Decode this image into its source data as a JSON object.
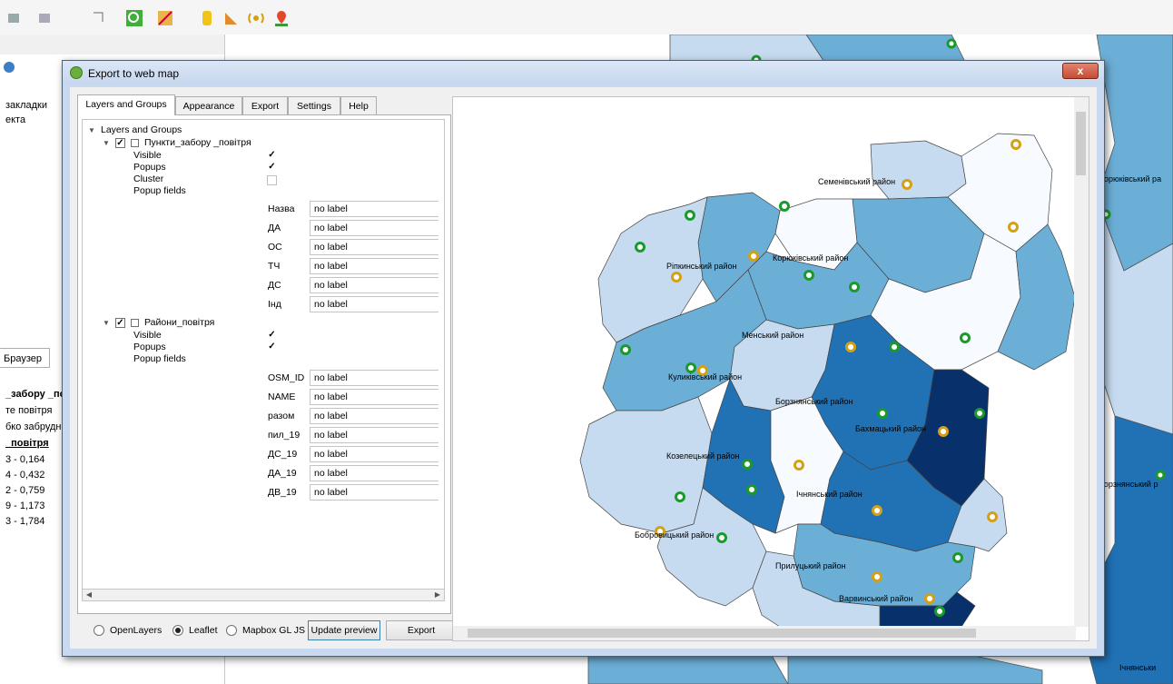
{
  "dialog": {
    "title": "Export to web map",
    "close_label": "x"
  },
  "tabs": [
    {
      "label": "Layers and Groups"
    },
    {
      "label": "Appearance"
    },
    {
      "label": "Export"
    },
    {
      "label": "Settings"
    },
    {
      "label": "Help"
    }
  ],
  "tree": {
    "root": "Layers and Groups",
    "layer1": {
      "name": "Пункти_забору _повітря",
      "visible_label": "Visible",
      "popups_label": "Popups",
      "cluster_label": "Cluster",
      "popup_fields_label": "Popup fields",
      "visible": true,
      "popups": true,
      "cluster": false,
      "fields": [
        {
          "name": "Назва",
          "value": "no label"
        },
        {
          "name": "ДА",
          "value": "no label"
        },
        {
          "name": "ОС",
          "value": "no label"
        },
        {
          "name": "ТЧ",
          "value": "no label"
        },
        {
          "name": "ДС",
          "value": "no label"
        },
        {
          "name": "Інд",
          "value": "no label"
        }
      ]
    },
    "layer2": {
      "name": "Райони_повітря",
      "visible_label": "Visible",
      "popups_label": "Popups",
      "popup_fields_label": "Popup fields",
      "visible": true,
      "popups": true,
      "fields": [
        {
          "name": "OSM_ID",
          "value": "no label"
        },
        {
          "name": "NAME",
          "value": "no label"
        },
        {
          "name": "разом",
          "value": "no label"
        },
        {
          "name": "пил_19",
          "value": "no label"
        },
        {
          "name": "ДС_19",
          "value": "no label"
        },
        {
          "name": "ДА_19",
          "value": "no label"
        },
        {
          "name": "ДВ_19",
          "value": "no label"
        }
      ]
    }
  },
  "bottom": {
    "radio_openlayers": "OpenLayers",
    "radio_leaflet": "Leaflet",
    "radio_mapbox": "Mapbox GL JS",
    "selected": "Leaflet",
    "update_preview": "Update preview",
    "export": "Export"
  },
  "map_labels": {
    "semenivskyi": "Семенівський район",
    "ripkynskyi": "Ріпкинський район",
    "koriukivskyi": "Корюківський район",
    "menskyi": "Менський район",
    "kulykivskyi": "Куликівський район",
    "borznianskyi": "Борзнянський район",
    "bakhmatskyi": "Бахмацький район",
    "kozeletskyi": "Козелецький район",
    "ichnianskyi": "Ічнянський район",
    "bobrovytskyi": "Бобровицький район",
    "prylutskyi": "Прилуцький район",
    "varvynskyi": "Варвинський район"
  },
  "background": {
    "left_panel_lines": [
      "закладки",
      "екта",
      "Браузер",
      "_забору _пов",
      "те повітря",
      "бко забрудн",
      "_повітря",
      "3 - 0,164",
      "4 - 0,432",
      "2 - 0,759",
      "9 - 1,173",
      "3 - 1,784"
    ],
    "bg_map_labels": [
      "орюківський ра",
      "Борзнянський р",
      "Ічнянськи"
    ]
  },
  "colors": {
    "very_light": "#f7fbff",
    "light": "#c6dbef",
    "medium": "#6baed6",
    "dark": "#2171b5",
    "very_dark": "#08306b",
    "point_green": "#1a9a2a",
    "point_gold": "#d4a016"
  }
}
